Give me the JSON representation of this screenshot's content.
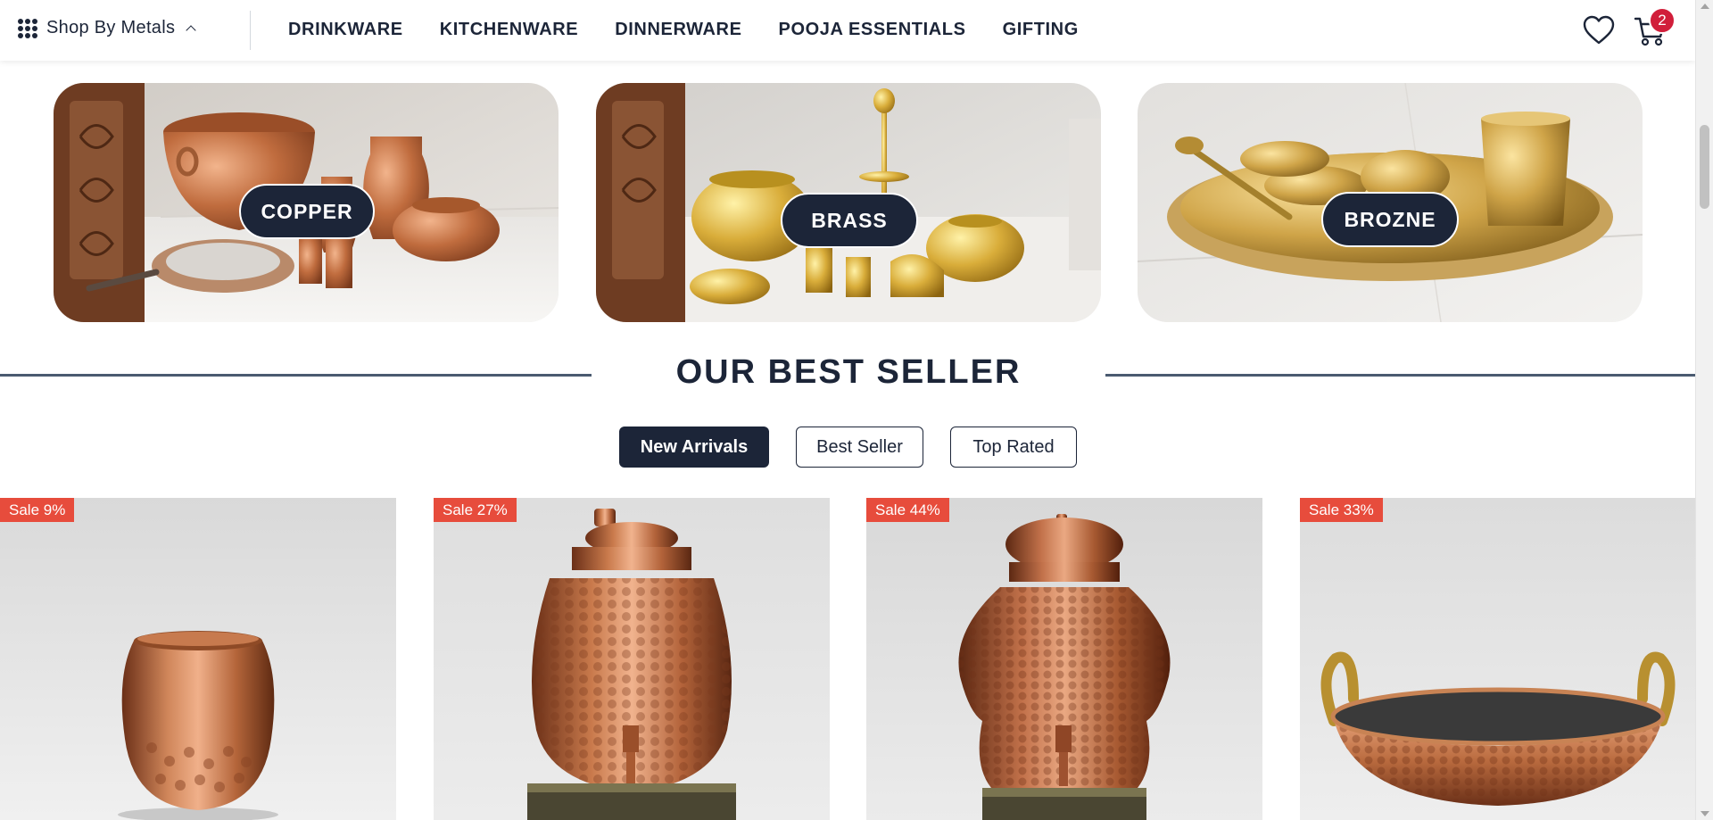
{
  "header": {
    "shop_by_label": "Shop By Metals",
    "nav": [
      "DRINKWARE",
      "KITCHENWARE",
      "DINNERWARE",
      "POOJA ESSENTIALS",
      "GIFTING"
    ],
    "cart_count": "2",
    "icons": {
      "menu": "grid-dots-icon",
      "wishlist": "heart-icon",
      "cart": "cart-icon",
      "chevron": "chevron-up-icon"
    }
  },
  "metals": [
    {
      "label": "COPPER"
    },
    {
      "label": "BRASS"
    },
    {
      "label": "BROZNE"
    }
  ],
  "best_seller": {
    "title": "OUR BEST SELLER",
    "tabs": [
      "New Arrivals",
      "Best Seller",
      "Top Rated"
    ],
    "active_tab": "New Arrivals"
  },
  "products": [
    {
      "badge": "Sale 9%"
    },
    {
      "badge": "Sale 27%"
    },
    {
      "badge": "Sale 44%"
    },
    {
      "badge": "Sale 33%"
    }
  ],
  "colors": {
    "navy": "#1c2538",
    "sale_red": "#e74c3c",
    "cart_badge": "#d11e3a",
    "copper": "#b8693e",
    "brass": "#d9b04a"
  }
}
